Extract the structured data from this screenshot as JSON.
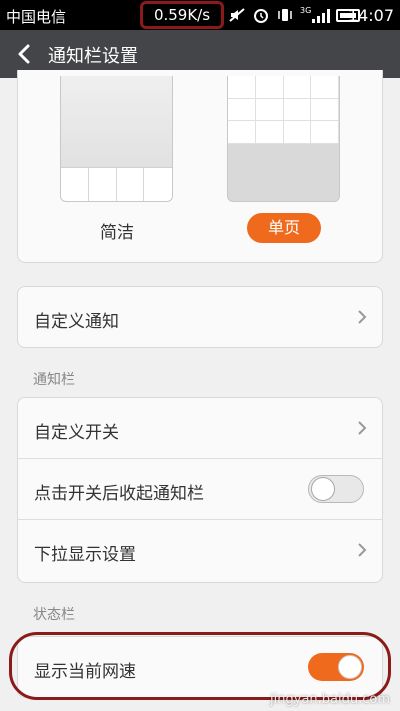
{
  "status_bar": {
    "carrier": "中国电信",
    "net_speed": "0.59K/s",
    "icons": [
      "mute-icon",
      "alarm-icon",
      "vibrate-icon",
      "3g-signal-icon",
      "battery-icon"
    ],
    "signal_label": "3G",
    "time": "14:07"
  },
  "title_bar": {
    "title": "通知栏设置",
    "back_icon": "chevron-left-icon"
  },
  "preview": {
    "option_simple": "简洁",
    "option_single_page": "单页",
    "selected": "单页",
    "accent_color": "#f06a1e"
  },
  "custom_notification": {
    "label": "自定义通知"
  },
  "notification_section": {
    "header": "通知栏",
    "rows": [
      {
        "label": "自定义开关",
        "type": "chevron"
      },
      {
        "label": "点击开关后收起通知栏",
        "type": "toggle",
        "on": false
      },
      {
        "label": "下拉显示设置",
        "type": "chevron"
      }
    ]
  },
  "status_section": {
    "header": "状态栏",
    "rows": [
      {
        "label": "显示当前网速",
        "type": "toggle",
        "on": true
      }
    ]
  },
  "watermark": "jingyan.baidu.com"
}
